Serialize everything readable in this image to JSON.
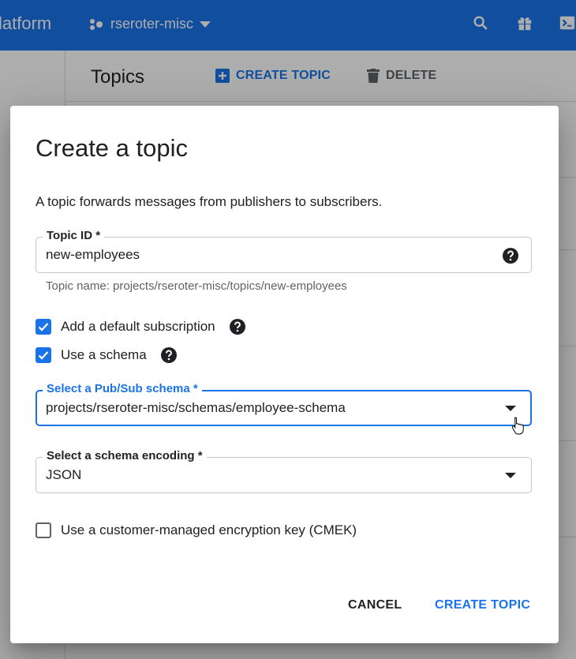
{
  "app": {
    "brand": "latform",
    "project": "rseroter-misc"
  },
  "background": {
    "page_title": "Topics",
    "create_topic_label": "CREATE TOPIC",
    "delete_label": "DELETE"
  },
  "dialog": {
    "title": "Create a topic",
    "description": "A topic forwards messages from publishers to subscribers.",
    "topic_id": {
      "label": "Topic ID *",
      "value": "new-employees",
      "hint": "Topic name: projects/rseroter-misc/topics/new-employees"
    },
    "default_subscription": {
      "label": "Add a default subscription",
      "checked": true
    },
    "use_schema": {
      "label": "Use a schema",
      "checked": true
    },
    "schema_select": {
      "label": "Select a Pub/Sub schema *",
      "value": "projects/rseroter-misc/schemas/employee-schema"
    },
    "encoding_select": {
      "label": "Select a schema encoding *",
      "value": "JSON"
    },
    "cmek": {
      "label": "Use a customer-managed encryption key (CMEK)",
      "checked": false
    },
    "cancel_label": "CANCEL",
    "create_label": "CREATE TOPIC"
  },
  "colors": {
    "primary": "#1a73e8",
    "text": "#202124",
    "muted": "#5f6368"
  }
}
